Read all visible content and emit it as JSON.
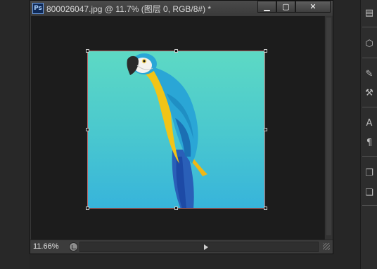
{
  "document": {
    "app_icon_text": "Ps",
    "title": "800026047.jpg @ 11.7% (图层 0, RGB/8#) *",
    "window_controls": {
      "minimize": "▁",
      "maximize": "▢",
      "close": "✕"
    }
  },
  "status_bar": {
    "zoom": "11.66%"
  },
  "canvas": {
    "background_gradient": [
      "#5dd9c4",
      "#37b4db"
    ],
    "image_subject": "parrot",
    "transform_handles_visible": true
  },
  "right_panel": {
    "tools": [
      {
        "icon": "history-icon",
        "glyph": "▤"
      },
      {
        "icon": "3d-cube-icon",
        "glyph": "⬡"
      },
      {
        "icon": "brush-preset-icon",
        "glyph": "✎"
      },
      {
        "icon": "clone-source-icon",
        "glyph": "⚒"
      },
      {
        "icon": "character-icon",
        "glyph": "A"
      },
      {
        "icon": "paragraph-icon",
        "glyph": "¶"
      },
      {
        "icon": "layers-icon",
        "glyph": "❐"
      },
      {
        "icon": "channels-icon",
        "glyph": "❏"
      }
    ]
  },
  "colors": {
    "window_bg": "#1c1c1c",
    "chrome": "#3a3a3a",
    "accent_ps": "#0f2a58"
  }
}
